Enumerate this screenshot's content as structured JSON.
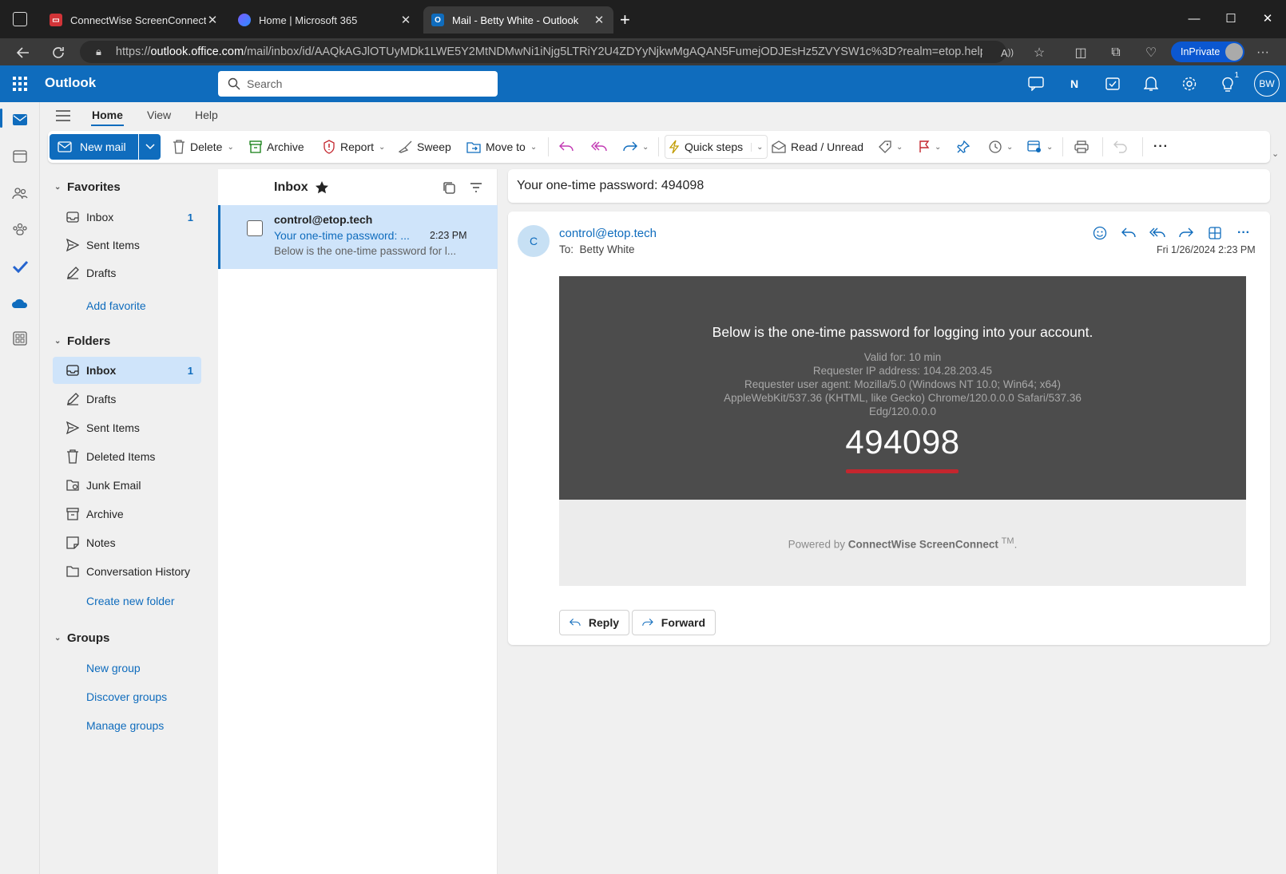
{
  "browser": {
    "tabs": [
      {
        "title": "ConnectWise ScreenConnect Remote Support",
        "favicon": "screenconnect-icon"
      },
      {
        "title": "Home | Microsoft 365",
        "favicon": "m365-icon"
      },
      {
        "title": "Mail - Betty White - Outlook",
        "favicon": "outlook-icon"
      }
    ],
    "url_prefix": "https://",
    "url_host": "outlook.office.com",
    "url_rest": "/mail/inbox/id/AAQkAGJlOTUyMDk1LWE5Y2MtNDMwNi1iNjg5LTRiY2U4ZDYyNjkwMgAQAN5FumejODJEsHz5ZVYSW1c%3D?realm=etop.help&exsvu...",
    "inprivate_label": "InPrivate"
  },
  "outlook": {
    "brand": "Outlook",
    "search_placeholder": "Search",
    "user_initials": "BW",
    "notification_count": "1"
  },
  "menu_tabs": [
    "Home",
    "View",
    "Help"
  ],
  "ribbon": {
    "new_mail": "New mail",
    "delete": "Delete",
    "archive": "Archive",
    "report": "Report",
    "sweep": "Sweep",
    "move_to": "Move to",
    "quick_steps": "Quick steps",
    "read_unread": "Read / Unread"
  },
  "nav": {
    "favorites_title": "Favorites",
    "favorites": [
      {
        "label": "Inbox",
        "count": "1"
      },
      {
        "label": "Sent Items",
        "count": ""
      },
      {
        "label": "Drafts",
        "count": ""
      }
    ],
    "add_favorite": "Add favorite",
    "folders_title": "Folders",
    "folders": [
      {
        "label": "Inbox",
        "count": "1"
      },
      {
        "label": "Drafts",
        "count": ""
      },
      {
        "label": "Sent Items",
        "count": ""
      },
      {
        "label": "Deleted Items",
        "count": ""
      },
      {
        "label": "Junk Email",
        "count": ""
      },
      {
        "label": "Archive",
        "count": ""
      },
      {
        "label": "Notes",
        "count": ""
      },
      {
        "label": "Conversation History",
        "count": ""
      }
    ],
    "create_folder": "Create new folder",
    "groups_title": "Groups",
    "groups_links": [
      "New group",
      "Discover groups",
      "Manage groups"
    ]
  },
  "message_list": {
    "title": "Inbox",
    "messages": [
      {
        "sender": "control@etop.tech",
        "subject": "Your one-time password: ...",
        "time": "2:23 PM",
        "preview": "Below is the one-time password for l..."
      }
    ]
  },
  "reading": {
    "subject": "Your one-time password: 494098",
    "sender_initial": "C",
    "sender": "control@etop.tech",
    "to_label": "To:",
    "to": "Betty White",
    "datetime": "Fri 1/26/2024 2:23 PM",
    "body_heading": "Below is the one-time password for logging into your account.",
    "body_lines": [
      "Valid for: 10 min",
      "Requester IP address: 104.28.203.45",
      "Requester user agent: Mozilla/5.0 (Windows NT 10.0; Win64; x64)",
      "AppleWebKit/537.36 (KHTML, like Gecko) Chrome/120.0.0.0 Safari/537.36",
      "Edg/120.0.0.0"
    ],
    "otp": "494098",
    "powered_by": "Powered by",
    "powered_brand": "ConnectWise ScreenConnect",
    "powered_tm": "TM",
    "powered_end": ".",
    "reply": "Reply",
    "forward": "Forward"
  },
  "colors": {
    "outlook_blue": "#0f6cbd",
    "selection": "#cfe4fa",
    "email_body_bg": "#4c4c4c",
    "otp_underline": "#c4262e"
  }
}
